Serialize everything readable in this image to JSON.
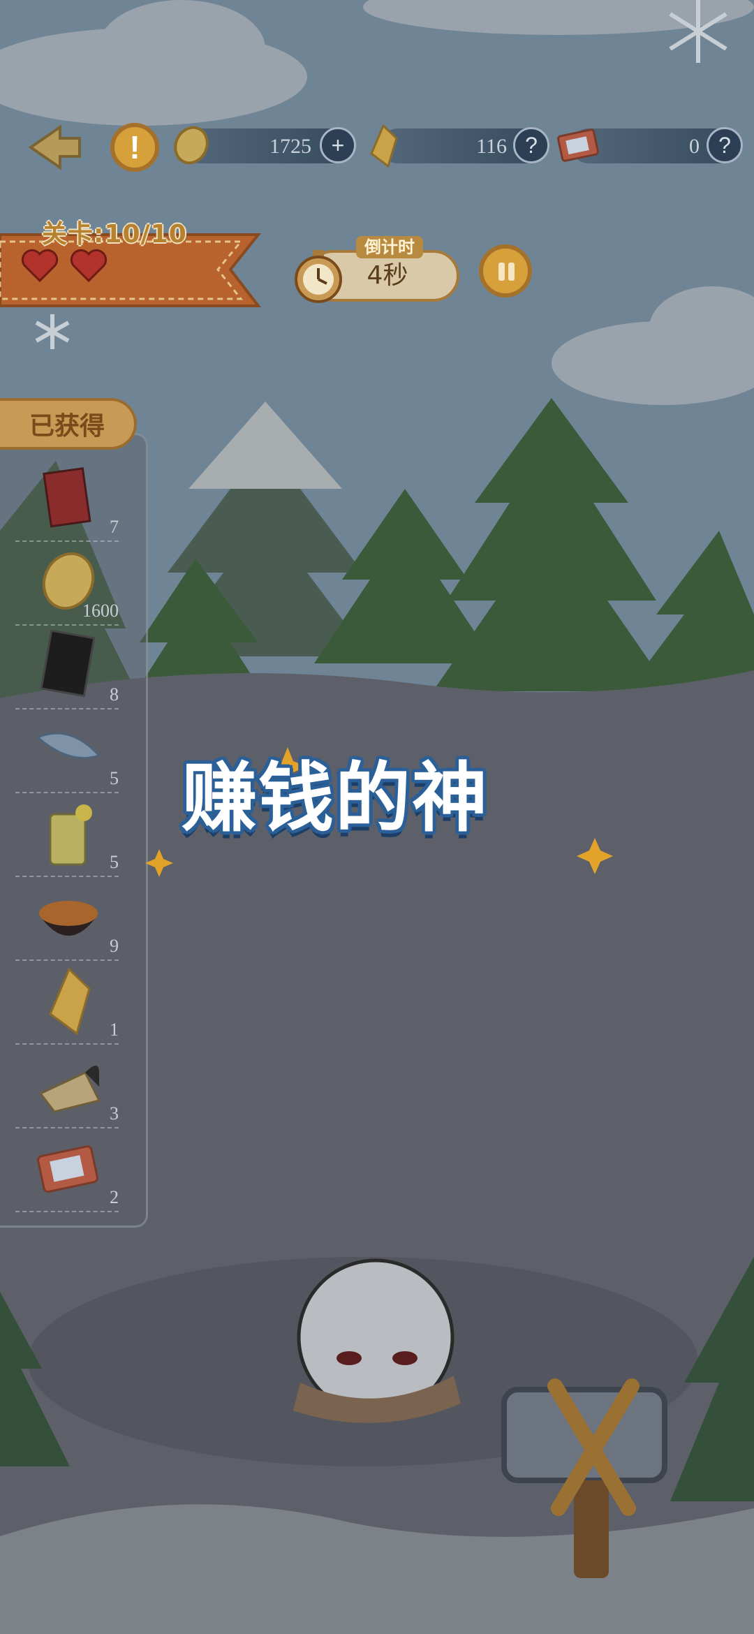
{
  "hud": {
    "coins": {
      "value": "1725",
      "icon": "coin-icon",
      "action_icon": "plus-icon"
    },
    "crystals": {
      "value": "116",
      "icon": "crystal-icon",
      "action_icon": "question-icon"
    },
    "tickets": {
      "value": "0",
      "icon": "ticket-icon",
      "action_icon": "question-icon"
    },
    "plus_symbol": "+",
    "question_symbol": "?",
    "warn_symbol": "!"
  },
  "level": {
    "label": "关卡:10/10",
    "hearts": 2
  },
  "timer": {
    "title": "倒计时",
    "value": "4秒"
  },
  "obtained": {
    "title": "已获得",
    "items": [
      {
        "icon": "red-book-icon",
        "count": "7"
      },
      {
        "icon": "coin-icon",
        "count": "1600"
      },
      {
        "icon": "black-card-icon",
        "count": "8"
      },
      {
        "icon": "feather-icon",
        "count": "5"
      },
      {
        "icon": "lemonade-icon",
        "count": "5"
      },
      {
        "icon": "rice-bowl-icon",
        "count": "9"
      },
      {
        "icon": "crystal-icon",
        "count": "1"
      },
      {
        "icon": "paper-fan-icon",
        "count": "3"
      },
      {
        "icon": "ticket-icon",
        "count": "2"
      }
    ]
  },
  "banner": {
    "text": "赚钱的神"
  },
  "colors": {
    "sky": "#8fb0c6",
    "overlay": "#5b5e66",
    "gold": "#d6a13a",
    "banner_outline": "#2b5f97"
  }
}
